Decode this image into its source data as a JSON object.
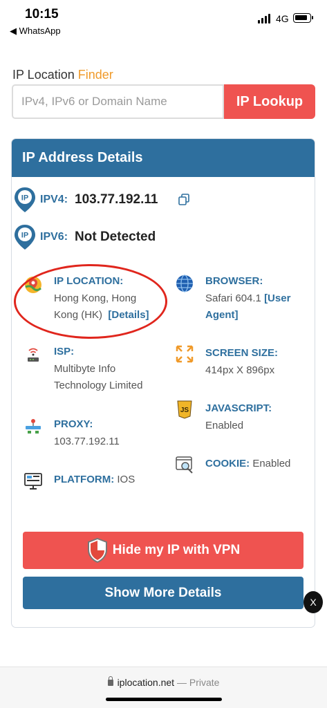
{
  "status_bar": {
    "time": "10:15",
    "back_app": "◀ WhatsApp",
    "network": "4G"
  },
  "finder": {
    "title_prefix": "IP Location ",
    "title_accent": "Finder",
    "accent_color": "#f09a2a",
    "placeholder": "IPv4, IPv6 or Domain Name",
    "value": "",
    "button_label": "IP Lookup"
  },
  "details": {
    "header": "IP Address Details",
    "ipv4": {
      "label": "IPV4:",
      "value": "103.77.192.11"
    },
    "ipv6": {
      "label": "IPV6:",
      "value": "Not Detected"
    },
    "location": {
      "label": "IP LOCATION:",
      "line1": "Hong Kong, Hong",
      "line2": "Kong (HK)",
      "link": "[Details]"
    },
    "browser": {
      "label": "BROWSER:",
      "line1_text": "Safari 604.1 ",
      "line1_link": "[User",
      "line2_link": "Agent]"
    },
    "isp": {
      "label": "ISP:",
      "line1": "Multibyte Info",
      "line2": "Technology Limited"
    },
    "screen": {
      "label": "SCREEN SIZE:",
      "value": "414px X 896px"
    },
    "javascript": {
      "label": "JAVASCRIPT:",
      "value": "Enabled"
    },
    "proxy": {
      "label": "PROXY:",
      "value": "103.77.192.11"
    },
    "cookie": {
      "label": "COOKIE:",
      "value": " Enabled"
    },
    "platform": {
      "label": "PLATFORM:",
      "value": " IOS"
    }
  },
  "actions": {
    "vpn_label": "Hide my IP with VPN",
    "more_label": "Show More Details",
    "close_label": "X"
  },
  "url_bar": {
    "domain": "iplocation.net",
    "suffix": " — Private"
  },
  "colors": {
    "brand_blue": "#2e6f9e",
    "brand_red": "#ef5350",
    "highlight_circle": "#e0261d"
  }
}
